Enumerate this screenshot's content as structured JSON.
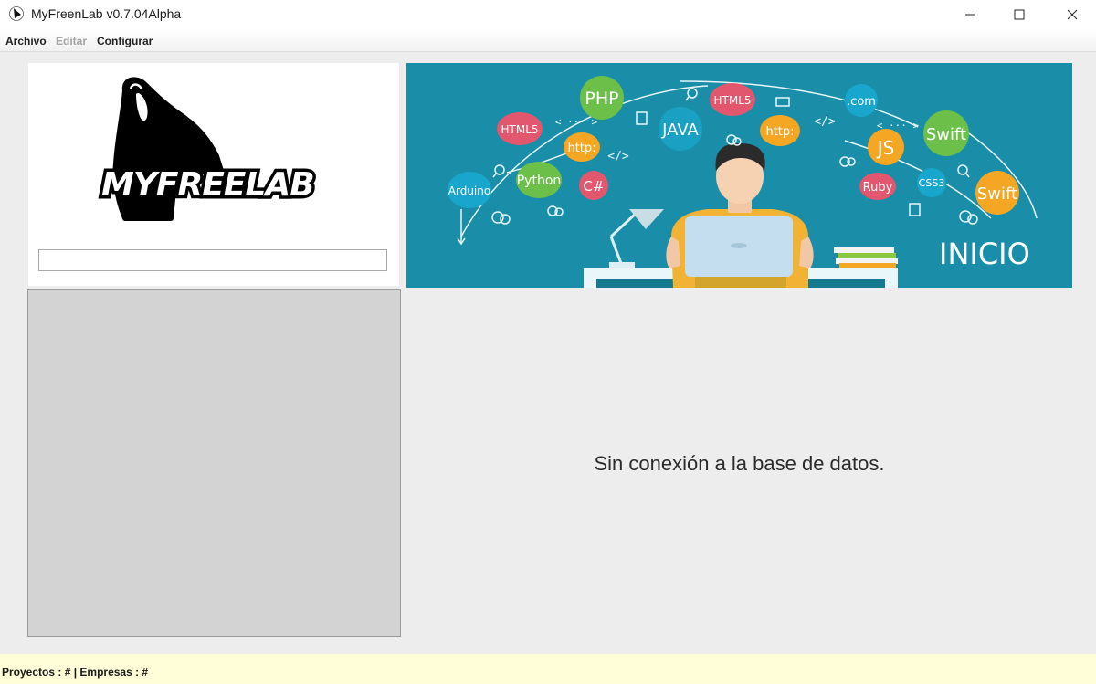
{
  "window": {
    "title": "MyFreenLab v0.7.04Alpha"
  },
  "menu": {
    "archivo": "Archivo",
    "editar": "Editar",
    "configurar": "Configurar"
  },
  "logo": {
    "text": "MYFREELAB"
  },
  "search": {
    "value": ""
  },
  "banner": {
    "title": "INICIO",
    "tags": {
      "php": "PHP",
      "html5_top": "HTML5",
      "java": "JAVA",
      "http_mid": "http:",
      "com": ".com",
      "swift_top": "Swift",
      "html5_left": "HTML5",
      "http_left": "http:",
      "python": "Python",
      "csharp": "C#",
      "arduino": "Arduino",
      "js": "JS",
      "ruby": "Ruby",
      "css3": "CSS3",
      "swift_right": "Swift"
    },
    "code_symbols": {
      "ellipsis_a": "< ··· >",
      "slash_a": "</>",
      "slash_b": "</>",
      "ellipsis_b": "< ··· >"
    }
  },
  "main": {
    "status": "Sin conexión a la base de datos."
  },
  "footer": {
    "text": "Proyectos : #  |  Empresas : #"
  },
  "colors": {
    "banner_bg": "#1a8ea8",
    "footer_bg": "#fffed8",
    "list_bg": "#d3d3d3"
  }
}
